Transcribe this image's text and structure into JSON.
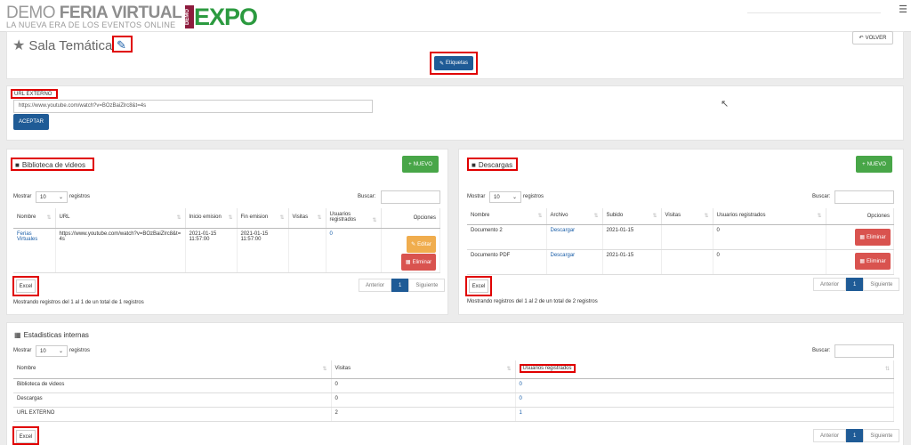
{
  "brand": {
    "demo": "DEMO ",
    "name": "FERIA VIRTUAL",
    "tagline": "LA NUEVA ERA DE LOS EVENTOS ONLINE",
    "expo_badge": "DEMO",
    "expo_text": "EXPO"
  },
  "header": {
    "menu_icon": "hamburger-icon"
  },
  "page": {
    "title": "Sala Temática",
    "back_label": "VOLVER",
    "tags_label": "Etiquetas"
  },
  "url_section": {
    "label": "URL EXTERNO",
    "value": "https://www.youtube.com/watch?v=BOzBaiZlrc8&t=4s",
    "submit_label": "ACEPTAR"
  },
  "videos": {
    "title": "Biblioteca de videos",
    "new_label": "NUEVO",
    "show_label": "Mostrar",
    "records_label": "registros",
    "page_size": "10",
    "search_label": "Buscar:",
    "columns": [
      "Nombre",
      "URL",
      "Inicio emision",
      "Fin emision",
      "Visitas",
      "Usuarios registrados",
      "Opciones"
    ],
    "rows": [
      {
        "name": "Ferias Virtuales",
        "url": "https://www.youtube.com/watch?v=BOzBaiZlrc8&t=4s",
        "start": "2021-01-15 11:57:00",
        "end": "2021-01-15 11:57:00",
        "visits": "",
        "registered": "0"
      }
    ],
    "edit_label": "Editar",
    "delete_label": "Eliminar",
    "excel_label": "Excel",
    "prev_label": "Anterior",
    "page": "1",
    "next_label": "Siguiente",
    "info": "Mostrando registros del 1 al 1 de un total de 1 registros"
  },
  "downloads": {
    "title": "Descargas",
    "new_label": "NUEVO",
    "show_label": "Mostrar",
    "records_label": "registros",
    "page_size": "10",
    "search_label": "Buscar:",
    "columns": [
      "Nombre",
      "Archivo",
      "Subido",
      "Visitas",
      "Usuarios registrados",
      "Opciones"
    ],
    "rows": [
      {
        "name": "Documento 2",
        "file": "Descargar",
        "uploaded": "2021-01-15",
        "visits": "",
        "registered": "0"
      },
      {
        "name": "Documento PDF",
        "file": "Descargar",
        "uploaded": "2021-01-15",
        "visits": "",
        "registered": "0"
      }
    ],
    "delete_label": "Eliminar",
    "excel_label": "Excel",
    "prev_label": "Anterior",
    "page": "1",
    "next_label": "Siguiente",
    "info": "Mostrando registros del 1 al 2 de un total de 2 registros"
  },
  "stats": {
    "title": "Estadisticas internas",
    "show_label": "Mostrar",
    "records_label": "registros",
    "page_size": "10",
    "search_label": "Buscar:",
    "columns": [
      "Nombre",
      "Visitas",
      "Usuarios registrados"
    ],
    "rows": [
      {
        "name": "Biblioteca de videos",
        "visits": "0",
        "registered": "0"
      },
      {
        "name": "Descargas",
        "visits": "0",
        "registered": "0"
      },
      {
        "name": "URL EXTERNO",
        "visits": "2",
        "registered": "1"
      }
    ],
    "excel_label": "Excel",
    "prev_label": "Anterior",
    "page": "1",
    "next_label": "Siguiente"
  },
  "colors": {
    "primary": "#1f5b96",
    "success": "#48a648",
    "warning": "#f0ad4e",
    "danger": "#d9534f",
    "highlight": "#e00000",
    "expo_green": "#2b9a3f",
    "expo_badge": "#8d1b3d"
  }
}
